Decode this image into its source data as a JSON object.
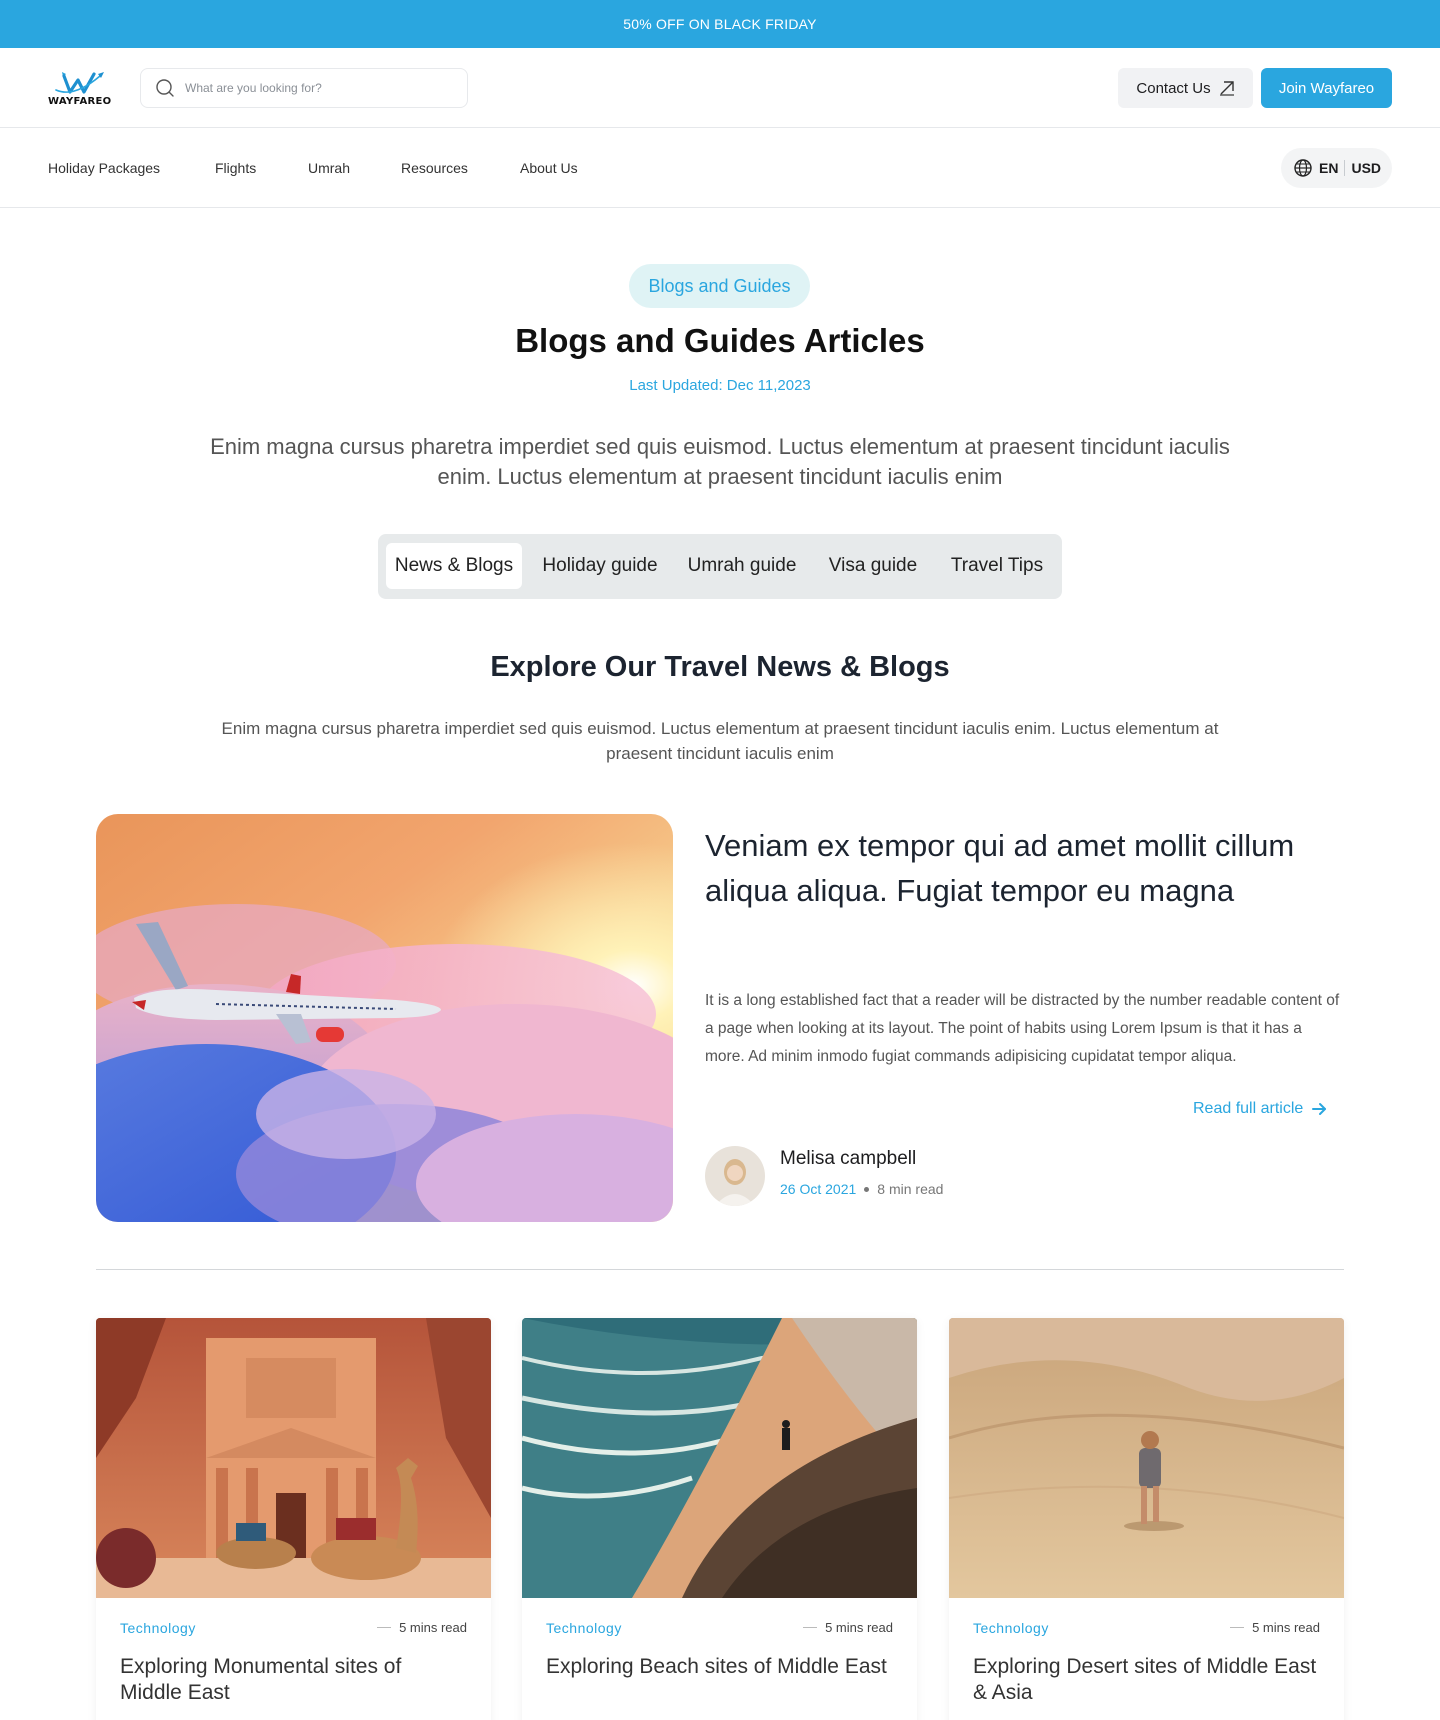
{
  "promo": {
    "text": "50% OFF ON BLACK FRIDAY"
  },
  "header": {
    "logo_text": "WAYFAREO",
    "search_placeholder": "What are you looking for?",
    "contact_label": "Contact Us",
    "join_label": "Join Wayfareo"
  },
  "nav": {
    "items": [
      "Holiday Packages",
      "Flights",
      "Umrah",
      "Resources",
      "About Us"
    ],
    "lang": "EN",
    "currency": "USD"
  },
  "hero": {
    "pill": "Blogs and Guides",
    "title": "Blogs and Guides Articles",
    "updated": "Last Updated: Dec 11,2023",
    "description": "Enim magna cursus pharetra imperdiet sed quis euismod. Luctus elementum at praesent tincidunt iaculis enim. Luctus elementum at praesent tincidunt iaculis enim"
  },
  "tabs": [
    "News & Blogs",
    "Holiday guide",
    "Umrah guide",
    "Visa guide",
    "Travel Tips"
  ],
  "section": {
    "title": "Explore Our Travel News & Blogs",
    "description": "Enim magna cursus pharetra imperdiet sed quis euismod. Luctus elementum at praesent tincidunt iaculis enim. Luctus elementum at praesent tincidunt iaculis enim"
  },
  "featured": {
    "title": "Veniam ex tempor qui ad amet mollit cillum aliqua aliqua. Fugiat tempor eu magna",
    "body": "It is a long established fact that a reader will be distracted by the number readable content of a page when looking at its layout. The point of habits using Lorem Ipsum is that it has a more. Ad minim inmodo fugiat commands adipisicing cupidatat tempor aliqua.",
    "read_more": "Read full article",
    "author": "Melisa campbell",
    "date": "26 Oct 2021",
    "read_time": "8 min read"
  },
  "cards": [
    {
      "category": "Technology",
      "read_time": "5 mins read",
      "title": "Exploring Monumental sites of Middle East"
    },
    {
      "category": "Technology",
      "read_time": "5 mins read",
      "title": "Exploring Beach sites of Middle East"
    },
    {
      "category": "Technology",
      "read_time": "5 mins read",
      "title": "Exploring Desert sites of Middle East & Asia"
    }
  ],
  "colors": {
    "accent": "#2aa6df",
    "pill_bg": "#dff3f5",
    "tabs_bg": "#e7eaeb"
  }
}
